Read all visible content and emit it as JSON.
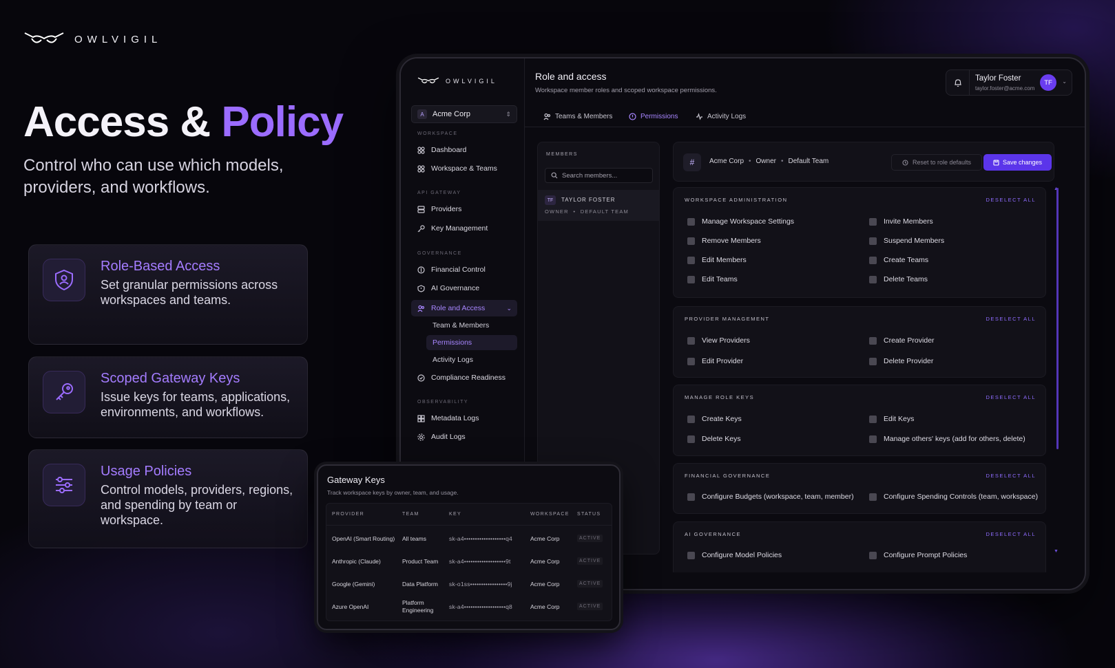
{
  "brand": {
    "name": "OWLVIGIL"
  },
  "hero": {
    "title_a": "Access & ",
    "title_b": "Policy",
    "subtitle": "Control who can use which models, providers, and workflows."
  },
  "features": [
    {
      "title": "Role-Based Access",
      "desc": "Set granular permissions across workspaces and teams.",
      "icon": "shield-user-icon"
    },
    {
      "title": "Scoped Gateway Keys",
      "desc": "Issue keys for teams, applications, environments, and workflows.",
      "icon": "key-icon"
    },
    {
      "title": "Usage Policies",
      "desc": "Control models, providers, regions, and spending by team or workspace.",
      "icon": "sliders-icon"
    }
  ],
  "app": {
    "brand": "OWLVIGIL",
    "workspace": {
      "badge": "A",
      "name": "Acme Corp"
    },
    "sidebar": {
      "sections": [
        "WORKSPACE",
        "API GATEWAY",
        "GOVERNANCE",
        "OBSERVABILITY"
      ],
      "items": {
        "dashboard": "Dashboard",
        "workspace_teams": "Workspace & Teams",
        "providers": "Providers",
        "key_management": "Key Management",
        "financial_control": "Financial Control",
        "ai_governance": "AI Governance",
        "role_access": "Role and Access",
        "team_members": "Team & Members",
        "permissions": "Permissions",
        "activity_logs": "Activity Logs",
        "compliance": "Compliance Readiness",
        "metadata_logs": "Metadata Logs",
        "audit_logs": "Audit Logs"
      }
    },
    "header": {
      "title": "Role and access",
      "subtitle": "Workspace member roles and scoped workspace permissions."
    },
    "user": {
      "name": "Taylor Foster",
      "email": "taylor.foster@acme.com",
      "initials": "TF"
    },
    "tabs": [
      "Teams & Members",
      "Permissions",
      "Activity Logs"
    ],
    "members": {
      "label": "MEMBERS",
      "search_placeholder": "Search members...",
      "member": {
        "initials": "TF",
        "name": "TAYLOR FOSTER",
        "role": "OWNER",
        "team": "DEFAULT TEAM"
      }
    },
    "perm_header": {
      "icon": "#",
      "org": "Acme Corp",
      "role": "Owner",
      "team": "Default Team",
      "reset": "Reset to role defaults",
      "save": "Save changes"
    },
    "deselect_label": "DESELECT ALL",
    "groups": [
      {
        "title": "WORKSPACE ADMINISTRATION",
        "items": [
          "Manage Workspace Settings",
          "Invite Members",
          "Remove Members",
          "Suspend Members",
          "Edit Members",
          "Create Teams",
          "Edit Teams",
          "Delete Teams"
        ]
      },
      {
        "title": "PROVIDER MANAGEMENT",
        "items": [
          "View Providers",
          "Create Provider",
          "Edit Provider",
          "Delete Provider"
        ]
      },
      {
        "title": "MANAGE ROLE KEYS",
        "items": [
          "Create Keys",
          "Edit Keys",
          "Delete Keys",
          "Manage others' keys (add for others, delete)"
        ]
      },
      {
        "title": "FINANCIAL GOVERNANCE",
        "items": [
          "Configure Budgets (workspace, team, member)",
          "Configure Spending Controls (team, workspace)"
        ]
      },
      {
        "title": "AI GOVERNANCE",
        "items": [
          "Configure Model Policies",
          "Configure Prompt Policies"
        ]
      }
    ]
  },
  "gateway_keys": {
    "title": "Gateway Keys",
    "subtitle": "Track workspace keys by owner, team, and usage.",
    "columns": [
      "PROVIDER",
      "TEAM",
      "KEY",
      "WORKSPACE",
      "STATUS"
    ],
    "rows": [
      {
        "provider": "OpenAI (Smart Routing)",
        "team": "All teams",
        "key": "sk-a4•••••••••••••••••••q4",
        "workspace": "Acme Corp",
        "status": "ACTIVE"
      },
      {
        "provider": "Anthropic (Claude)",
        "team": "Product Team",
        "key": "sk-a4•••••••••••••••••••9t",
        "workspace": "Acme Corp",
        "status": "ACTIVE"
      },
      {
        "provider": "Google (Gemini)",
        "team": "Data Platform",
        "key": "sk-o1ss•••••••••••••••••9j",
        "workspace": "Acme Corp",
        "status": "ACTIVE"
      },
      {
        "provider": "Azure OpenAI",
        "team": "Platform Engineering",
        "key": "sk-a4•••••••••••••••••••q8",
        "workspace": "Acme Corp",
        "status": "ACTIVE"
      }
    ]
  },
  "colors": {
    "accent": "#9b6cff",
    "primary_button": "#5b35ea",
    "avatar": "#6a3df0",
    "background": "#07060c"
  }
}
